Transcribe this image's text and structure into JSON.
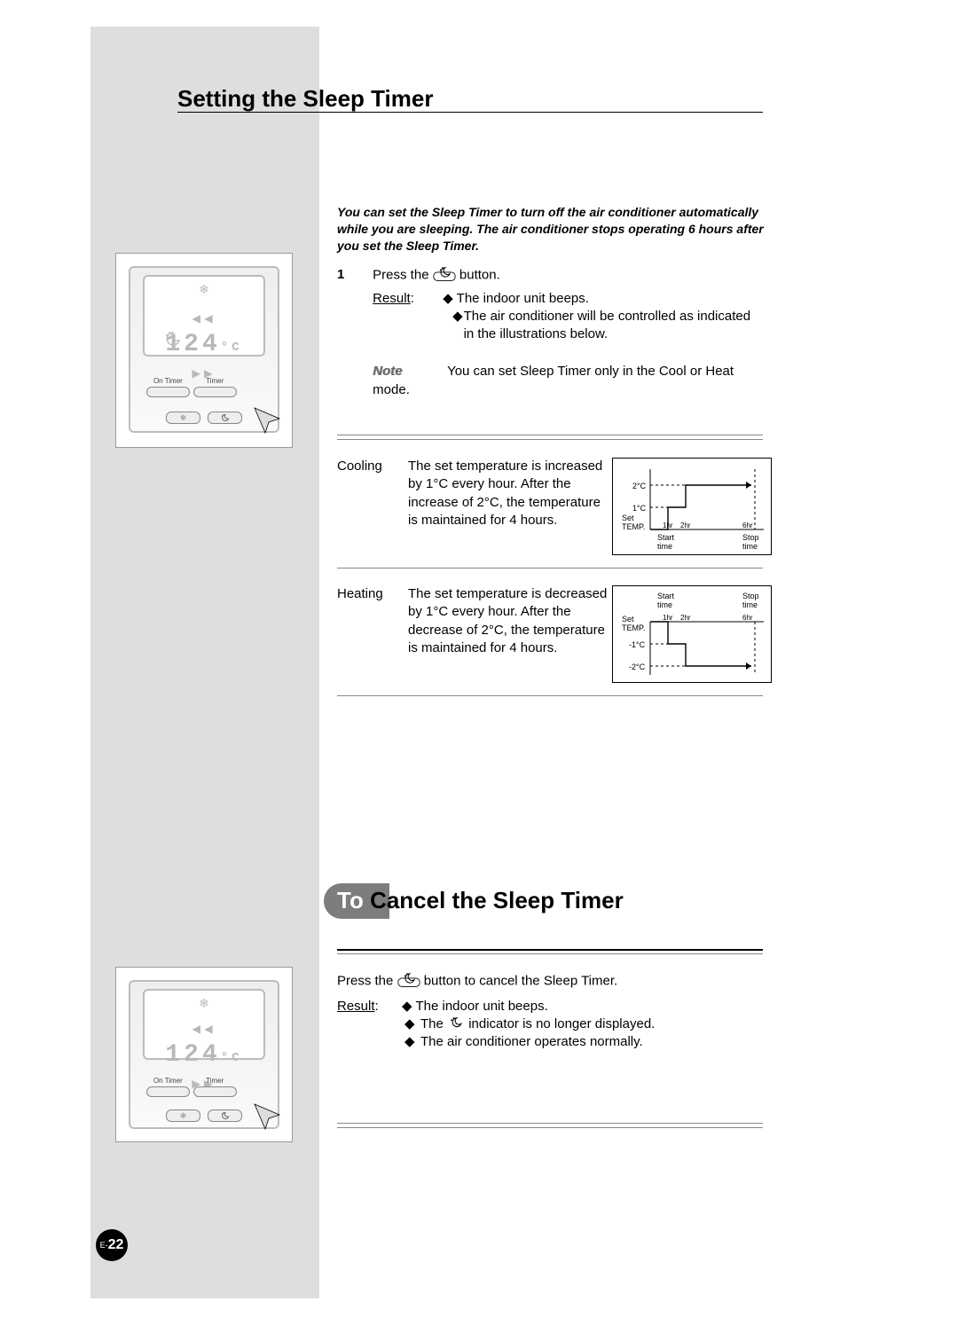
{
  "title1": "Setting the Sleep Timer",
  "intro": "You can set the Sleep Timer to turn off the air conditioner automatically while you are sleeping. The air conditioner stops operating 6 hours after you set the Sleep Timer.",
  "remote": {
    "display_temp": "124",
    "temp_unit": "°C",
    "buttons": {
      "on_timer": "On Timer",
      "timer": "Timer"
    }
  },
  "step1": {
    "num": "1",
    "press_a": "Press the",
    "press_b": "button.",
    "result_label": "Result",
    "bullets": [
      "The indoor unit beeps.",
      "The air conditioner will be controlled as indicated in the illustrations below."
    ],
    "note_label": "Note",
    "note": "You can set Sleep Timer only in the Cool or Heat mode."
  },
  "modes": {
    "cooling": {
      "label": "Cooling",
      "desc": "The set temperature is increased by 1°C every hour. After the increase of 2°C, the temperature is maintained for 4 hours."
    },
    "heating": {
      "label": "Heating",
      "desc": "The set temperature is decreased by 1°C every hour. After the decrease of 2°C, the temperature is maintained for 4 hours."
    }
  },
  "chart_data": [
    {
      "type": "line",
      "title": "",
      "xlabel": "",
      "ylabel": "Set TEMP.",
      "x": [
        0,
        1,
        2,
        6
      ],
      "values": [
        0,
        1,
        2,
        2
      ],
      "x_ticks": [
        "1hr",
        "2hr",
        "6hr"
      ],
      "y_ticks": [
        "1°C",
        "2°C"
      ],
      "x_start_label": "Start time",
      "x_end_label": "Stop time",
      "ylim": [
        0,
        2
      ]
    },
    {
      "type": "line",
      "title": "",
      "xlabel": "",
      "ylabel": "Set TEMP.",
      "x": [
        0,
        1,
        2,
        6
      ],
      "values": [
        0,
        -1,
        -2,
        -2
      ],
      "x_ticks": [
        "1hr",
        "2hr",
        "6hr"
      ],
      "y_ticks": [
        "-1°C",
        "-2°C"
      ],
      "x_start_label": "Start time",
      "x_end_label": "Stop time",
      "ylim": [
        -2,
        0
      ]
    }
  ],
  "chart_labels": {
    "set_temp": "Set TEMP.",
    "start": "Start time",
    "stop": "Stop time",
    "h1": "1hr",
    "h2": "2hr",
    "h6": "6hr",
    "c1": "1°C",
    "c2": "2°C",
    "cm1": "-1°C",
    "cm2": "-2°C"
  },
  "title2_pre": "To",
  "title2_post": " Cancel the Sleep Timer",
  "cancel": {
    "press_a": "Press the",
    "press_b": "button to cancel the Sleep Timer.",
    "result_label": "Result",
    "bullets_a": "The indoor unit beeps.",
    "bullets_b1": "The",
    "bullets_b2": "indicator is no longer displayed.",
    "bullets_c": "The air conditioner operates normally."
  },
  "page_prefix": "E-",
  "page_number": "22"
}
